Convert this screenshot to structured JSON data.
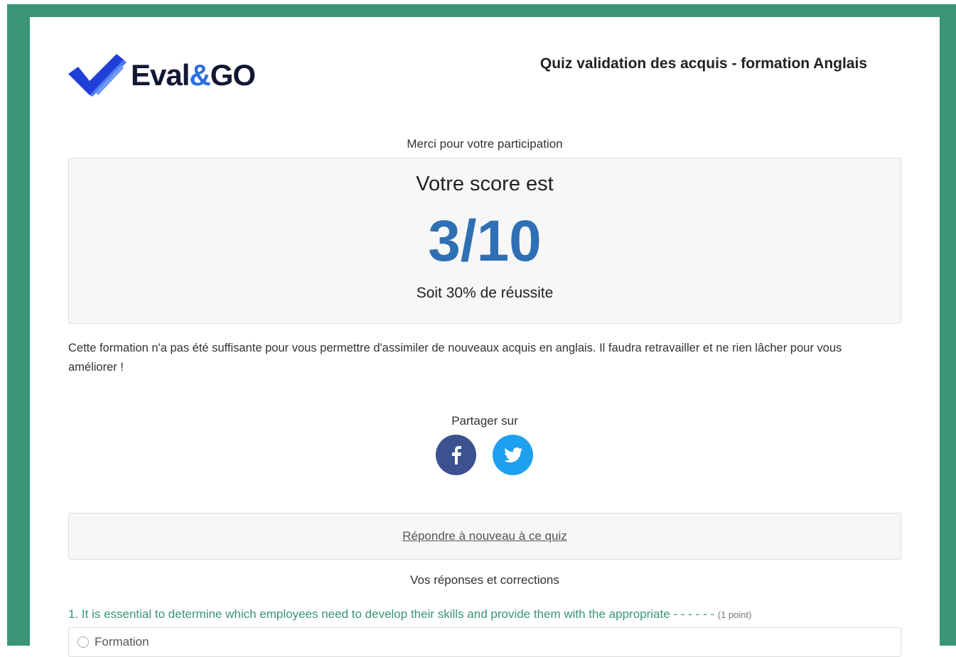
{
  "header": {
    "logo": {
      "text_main": "Eval",
      "text_amp": "&",
      "text_end": "GO"
    },
    "quiz_title": "Quiz validation des acquis - formation Anglais"
  },
  "result": {
    "thanks": "Merci pour votre participation",
    "score_label": "Votre score est",
    "score_value": "3/10",
    "score_fraction": 0.3,
    "score_percent_text": "Soit 30% de réussite",
    "feedback": "Cette formation n'a pas été suffisante pour vous permettre d'assimiler de nouveaux acquis en anglais. Il faudra retravailler et ne rien lâcher pour vous améliorer !"
  },
  "share": {
    "label": "Partager sur",
    "buttons": [
      {
        "icon": "facebook-icon",
        "color": "#3b5190"
      },
      {
        "icon": "twitter-icon",
        "color": "#1da0ef"
      }
    ]
  },
  "retry": {
    "label": "Répondre à nouveau à ce quiz"
  },
  "answers": {
    "heading": "Vos réponses et corrections",
    "questions": [
      {
        "text": "1. It is essential to determine which employees need to develop their skills and provide them with the appropriate - - - - - -",
        "points": "(1 point)",
        "options": [
          {
            "label": "Formation",
            "selected": false
          }
        ]
      }
    ]
  },
  "colors": {
    "frame": "#3a9478",
    "score": "#2f6fb3",
    "question": "#3a9478",
    "logo_text": "#121733",
    "logo_accent": "#2b6fe0"
  }
}
